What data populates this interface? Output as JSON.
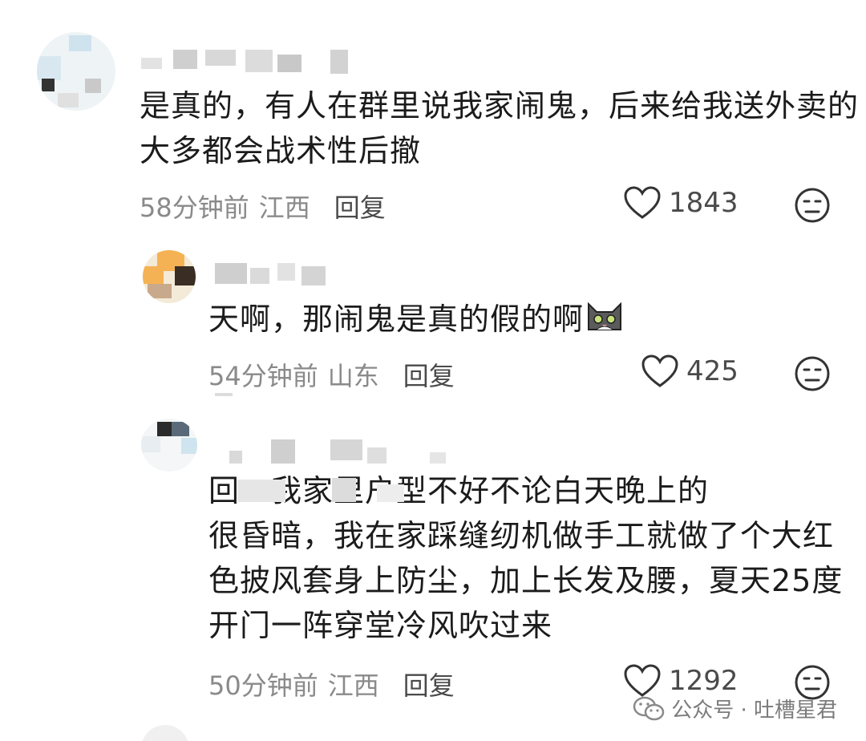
{
  "comments": [
    {
      "text_lines": [
        "是真的，有人在群里说我家闹鬼，后来给我送外卖的",
        "大多都会战术性后撤"
      ],
      "time": "58分钟前",
      "location": "江西",
      "reply_label": "回复",
      "likes": "1843"
    },
    {
      "text_lines": [
        "天啊，那闹鬼是真的假的啊"
      ],
      "time": "54分钟前",
      "location": "山东",
      "reply_label": "回复",
      "likes": "425"
    },
    {
      "text_lines": [
        "回：我家里户型不好不论白天晚上的",
        "很昏暗，我在家踩缝纫机做手工就做了个大红",
        "色披风套身上防尘，加上长发及腰，夏天25度",
        "开门一阵穿堂冷风吹过来"
      ],
      "time": "50分钟前",
      "location": "江西",
      "reply_label": "回复",
      "likes": "1292"
    }
  ],
  "watermark": {
    "text": "公众号 · 吐槽星君"
  },
  "icons": {
    "like": "heart-outline-icon",
    "dislike": "meh-face-icon",
    "emoji": "cat-face-emoji-icon",
    "wechat": "wechat-logo-icon"
  }
}
